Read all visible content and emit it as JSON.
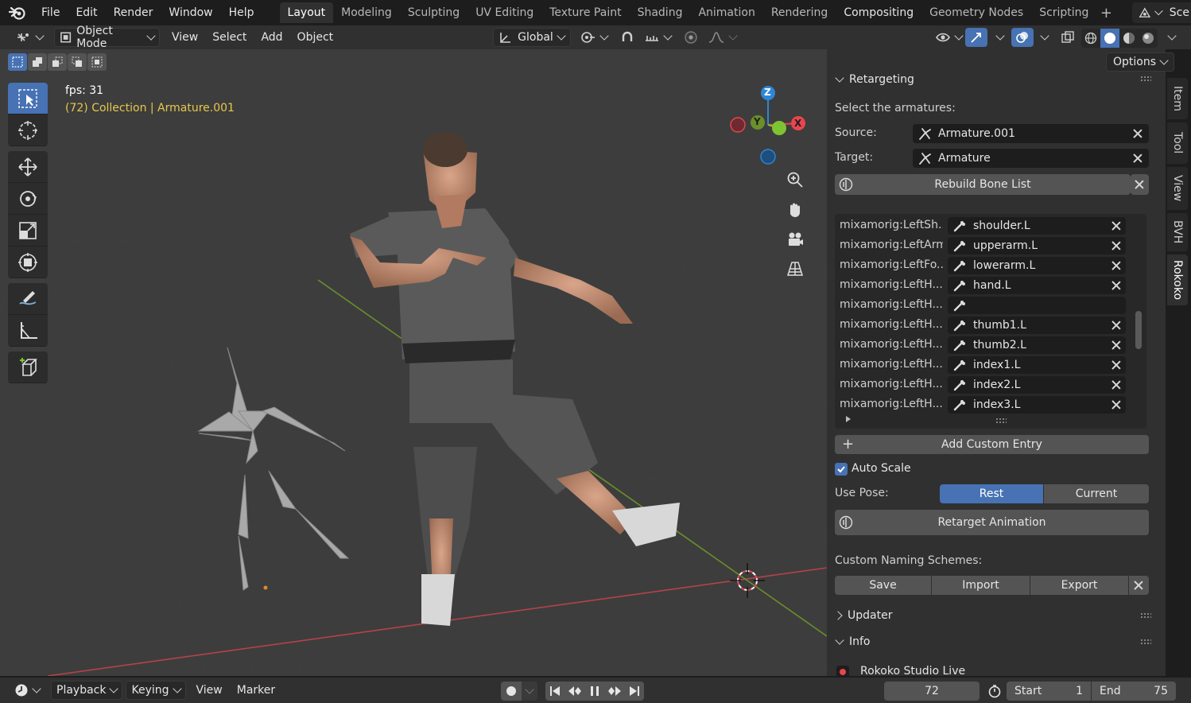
{
  "topbar": {
    "menus": [
      "File",
      "Edit",
      "Render",
      "Window",
      "Help"
    ],
    "workspaces": [
      "Layout",
      "Modeling",
      "Sculpting",
      "UV Editing",
      "Texture Paint",
      "Shading",
      "Animation",
      "Rendering",
      "Compositing",
      "Geometry Nodes",
      "Scripting"
    ],
    "active_workspace": "Layout",
    "scene_label": "Sce"
  },
  "header": {
    "mode": "Object Mode",
    "menus": [
      "View",
      "Select",
      "Add",
      "Object"
    ],
    "transform_orientation": "Global"
  },
  "viewport": {
    "fps": "fps: 31",
    "collection_info": "(72) Collection | Armature.001",
    "gizmo_axes": [
      "Z",
      "Y",
      "X"
    ],
    "axis_colors": {
      "x": "#e8454e",
      "y": "#7ec432",
      "z": "#2e86d6"
    }
  },
  "npanel": {
    "options_label": "Options",
    "retargeting": {
      "title": "Retargeting",
      "select_label": "Select the armatures:",
      "source_label": "Source:",
      "source_value": "Armature.001",
      "target_label": "Target:",
      "target_value": "Armature",
      "rebuild_label": "Rebuild Bone List",
      "bones": [
        {
          "source": "mixamorig:LeftSh...",
          "target": "shoulder.L"
        },
        {
          "source": "mixamorig:LeftArm",
          "target": "upperarm.L"
        },
        {
          "source": "mixamorig:LeftFo...",
          "target": "lowerarm.L"
        },
        {
          "source": "mixamorig:LeftH...",
          "target": "hand.L"
        },
        {
          "source": "mixamorig:LeftH...",
          "target": ""
        },
        {
          "source": "mixamorig:LeftH...",
          "target": "thumb1.L"
        },
        {
          "source": "mixamorig:LeftH...",
          "target": "thumb2.L"
        },
        {
          "source": "mixamorig:LeftH...",
          "target": "index1.L"
        },
        {
          "source": "mixamorig:LeftH...",
          "target": "index2.L"
        },
        {
          "source": "mixamorig:LeftH...",
          "target": "index3.L"
        }
      ],
      "add_custom_label": "Add Custom Entry",
      "auto_scale_label": "Auto Scale",
      "auto_scale_checked": true,
      "use_pose_label": "Use Pose:",
      "pose_options": [
        "Rest",
        "Current"
      ],
      "pose_selected": "Rest",
      "retarget_label": "Retarget Animation",
      "naming_label": "Custom Naming Schemes:",
      "naming_buttons": [
        "Save",
        "Import",
        "Export"
      ]
    },
    "updater_title": "Updater",
    "info_title": "Info",
    "info_item": "Rokoko Studio Live"
  },
  "rtabs": [
    "Item",
    "Tool",
    "View",
    "BVH",
    "Rokoko"
  ],
  "rtab_active": "Rokoko",
  "timeline": {
    "menus": [
      "Playback",
      "Keying",
      "View",
      "Marker"
    ],
    "current_frame": "72",
    "start_label": "Start",
    "start_value": "1",
    "end_label": "End",
    "end_value": "75"
  },
  "colors": {
    "accent": "#4772b3",
    "panel_bg": "#303030",
    "viewport_bg": "#3d3d3d"
  }
}
